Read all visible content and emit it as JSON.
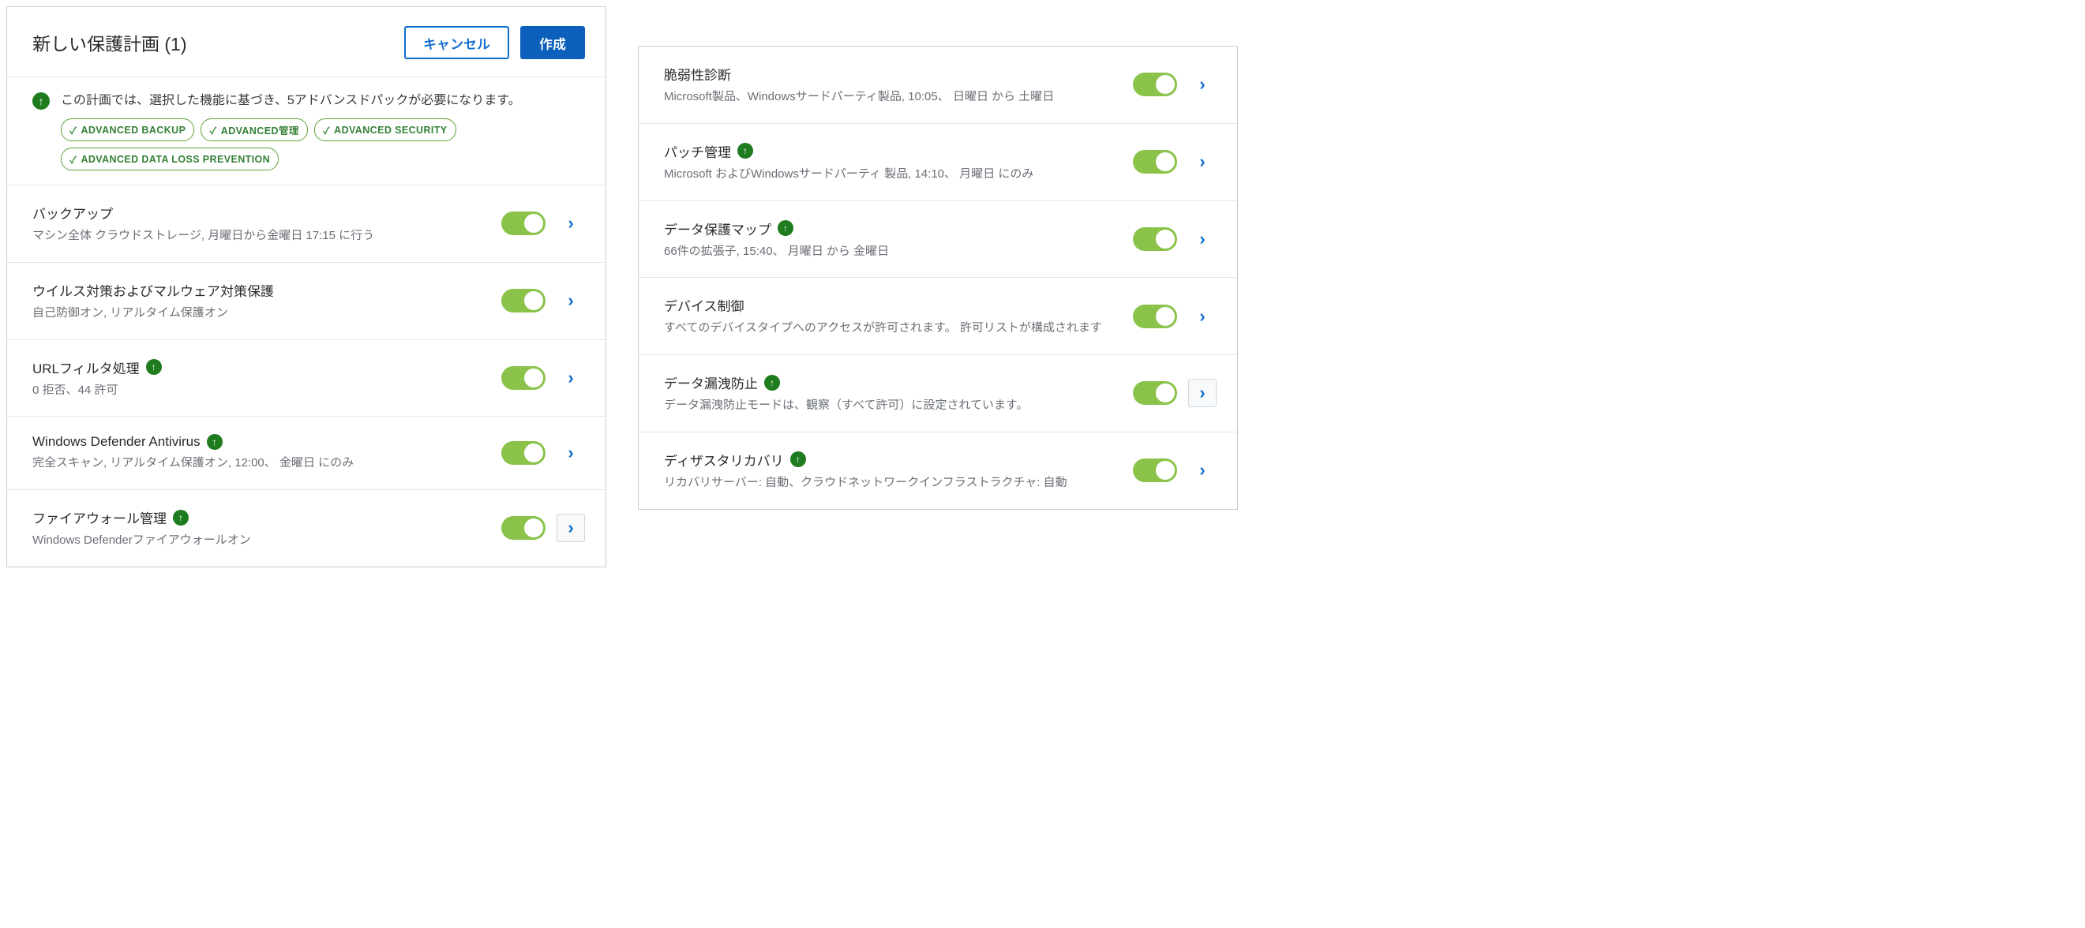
{
  "header": {
    "title": "新しい保護計画 (1)",
    "cancel_label": "キャンセル",
    "create_label": "作成"
  },
  "info": {
    "text": "この計画では、選択した機能に基づき、5アドバンスドパックが必要になります。",
    "pills": [
      "ADVANCED BACKUP",
      "ADVANCED管理",
      "ADVANCED SECURITY",
      "ADVANCED DATA LOSS PREVENTION"
    ]
  },
  "left_features": [
    {
      "title": "バックアップ",
      "desc": "マシン全体 クラウドストレージ, 月曜日から金曜日 17:15 に行う",
      "advanced": false,
      "boxed": false
    },
    {
      "title": "ウイルス対策およびマルウェア対策保護",
      "desc": "自己防御オン, リアルタイム保護オン",
      "advanced": false,
      "boxed": false
    },
    {
      "title": "URLフィルタ処理",
      "desc": "0 拒否、44 許可",
      "advanced": true,
      "boxed": false
    },
    {
      "title": "Windows Defender Antivirus",
      "desc": "完全スキャン, リアルタイム保護オン, 12:00、 金曜日 にのみ",
      "advanced": true,
      "boxed": false
    },
    {
      "title": "ファイアウォール管理",
      "desc": "Windows Defenderファイアウォールオン",
      "advanced": true,
      "boxed": true
    }
  ],
  "right_features": [
    {
      "title": "脆弱性診断",
      "desc": "Microsoft製品、Windowsサードパーティ製品, 10:05、 日曜日 から 土曜日",
      "advanced": false,
      "boxed": false
    },
    {
      "title": "パッチ管理",
      "desc": "Microsoft およびWindowsサードパーティ 製品, 14:10、 月曜日 にのみ",
      "advanced": true,
      "boxed": false
    },
    {
      "title": "データ保護マップ",
      "desc": "66件の拡張子, 15:40、 月曜日 から 金曜日",
      "advanced": true,
      "boxed": false
    },
    {
      "title": "デバイス制御",
      "desc": "すべてのデバイスタイプへのアクセスが許可されます。 許可リストが構成されます",
      "advanced": false,
      "boxed": false
    },
    {
      "title": "データ漏洩防止",
      "desc": "データ漏洩防止モードは、観察（すべて許可）に設定されています。",
      "advanced": true,
      "boxed": true
    },
    {
      "title": "ディザスタリカバリ",
      "desc": "リカバリサーバー: 自動、クラウドネットワークインフラストラクチャ: 自動",
      "advanced": true,
      "boxed": false
    }
  ]
}
